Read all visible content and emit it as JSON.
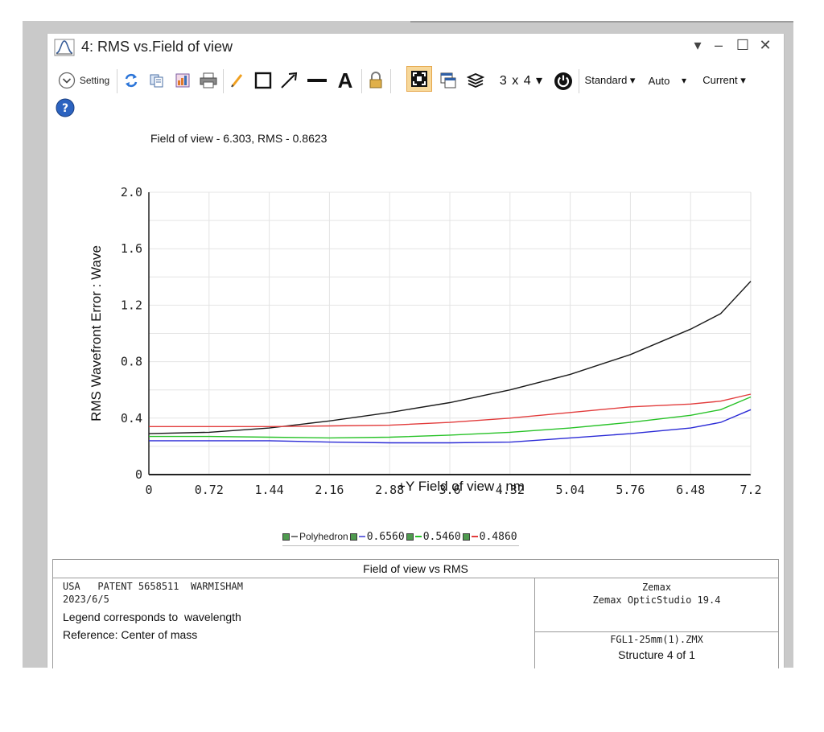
{
  "window": {
    "title": "4: RMS vs.Field of view",
    "controls": {
      "menu": "▾",
      "minimize": "‒",
      "maximize": "☐",
      "close": "✕"
    }
  },
  "toolbar": {
    "settings_label": "Setting",
    "layout_label": "3 x 4 ▾",
    "standard_label": "Standard ▾",
    "auto_label": "Auto",
    "auto_arrow": "▾",
    "current_label": "Current ▾",
    "text_tool": "A"
  },
  "chart_data": {
    "type": "line",
    "title": "Field of view - 6.303, RMS - 0.8623",
    "xlabel": "+Y Field of view : nm",
    "ylabel": "RMS Wavefront Error : Wave",
    "xlim": [
      0,
      7.2
    ],
    "ylim": [
      0,
      2.0
    ],
    "x_ticks": [
      "0",
      "0.72",
      "1.44",
      "2.16",
      "2.88",
      "3.6",
      "4.32",
      "5.04",
      "5.76",
      "6.48",
      "7.2"
    ],
    "y_ticks": [
      "0",
      "0.4",
      "0.8",
      "1.2",
      "1.6",
      "2.0"
    ],
    "grid": true,
    "x": [
      0,
      0.72,
      1.44,
      2.16,
      2.88,
      3.6,
      4.32,
      5.04,
      5.76,
      6.48,
      6.84,
      7.2
    ],
    "series": [
      {
        "name": "Polyhedron",
        "color": "#1a1a1a",
        "values": [
          0.29,
          0.3,
          0.33,
          0.38,
          0.44,
          0.51,
          0.6,
          0.71,
          0.85,
          1.03,
          1.14,
          1.37
        ]
      },
      {
        "name": "0.6560",
        "color": "#e23c3c",
        "values": [
          0.34,
          0.34,
          0.34,
          0.345,
          0.35,
          0.37,
          0.4,
          0.44,
          0.48,
          0.5,
          0.52,
          0.57
        ]
      },
      {
        "name": "0.5460",
        "color": "#27c227",
        "values": [
          0.27,
          0.27,
          0.265,
          0.26,
          0.265,
          0.28,
          0.3,
          0.33,
          0.37,
          0.42,
          0.46,
          0.55
        ]
      },
      {
        "name": "0.4860",
        "color": "#2b2bd6",
        "values": [
          0.24,
          0.24,
          0.24,
          0.23,
          0.225,
          0.225,
          0.23,
          0.26,
          0.29,
          0.33,
          0.37,
          0.46
        ]
      }
    ]
  },
  "legend": {
    "items": [
      {
        "label": "Polyhedron",
        "color": "#1a1a1a"
      },
      {
        "label": "0.6560",
        "color": "#6b6be0"
      },
      {
        "label": "0.5460",
        "color": "#27c227"
      },
      {
        "label": "0.4860",
        "color": "#e23c3c"
      }
    ]
  },
  "info": {
    "header": "Field of view  vs RMS",
    "line1": "USA   PATENT 5658511  WARMISHAM",
    "line2": "2023/6/5",
    "line3": "Legend corresponds to  wavelength",
    "line4": "Reference: Center of mass",
    "company": "Zemax",
    "product": "Zemax OpticStudio 19.4",
    "filename": "FGL1-25mm(1).ZMX",
    "structure": "Structure 4 of 1"
  }
}
